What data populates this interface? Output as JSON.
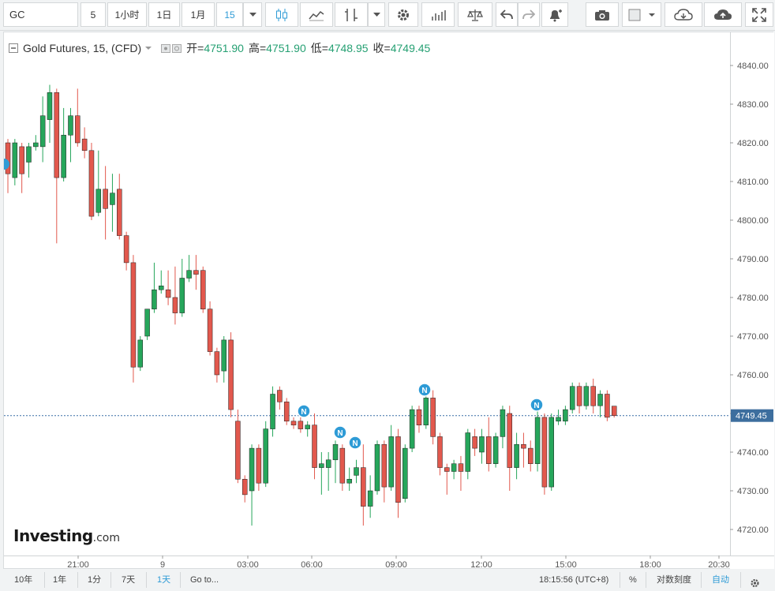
{
  "toolbar": {
    "symbol": "GC",
    "intervals": [
      "5",
      "1小时",
      "1日",
      "1月",
      "15"
    ],
    "active_interval": "15"
  },
  "legend": {
    "title": "Gold Futures, 15, (CFD)",
    "open_label": "开=",
    "open": "4751.90",
    "high_label": "高=",
    "high": "4751.90",
    "low_label": "低=",
    "low": "4748.95",
    "close_label": "收=",
    "close": "4749.45"
  },
  "logo": {
    "main": "Investing",
    "suffix": ".com"
  },
  "bottom": {
    "ranges": [
      "10年",
      "1年",
      "1分",
      "7天",
      "1天"
    ],
    "active_range": "1天",
    "goto": "Go to...",
    "clock": "18:15:56 (UTC+8)",
    "percent": "%",
    "log": "对数刻度",
    "auto": "自动"
  },
  "colors": {
    "up": "#26a65b",
    "down": "#e2584d",
    "accent": "#2e9bd6",
    "price_line": "#3a6ea5",
    "price_tag": "#3d6e9e"
  },
  "chart_data": {
    "type": "candlestick",
    "yticks": [
      4720,
      4730,
      4740,
      4750,
      4760,
      4770,
      4780,
      4790,
      4800,
      4810,
      4820,
      4830,
      4840
    ],
    "ylim": [
      4718,
      4843
    ],
    "xticks": [
      "21:00",
      "9",
      "03:00",
      "06:00",
      "09:00",
      "12:00",
      "15:00",
      "18:00",
      "20:30"
    ],
    "current_price": "4749.45",
    "news_markers": [
      "N",
      "N",
      "N",
      "N",
      "N"
    ],
    "candles": [
      [
        4820,
        4812,
        4821,
        4807
      ],
      [
        4811,
        4820,
        4821,
        4809
      ],
      [
        4819,
        4812,
        4820,
        4807
      ],
      [
        4815,
        4819,
        4820,
        4811
      ],
      [
        4819,
        4820,
        4822,
        4818
      ],
      [
        4819,
        4827,
        4832,
        4815
      ],
      [
        4826,
        4833,
        4835,
        4820
      ],
      [
        4833,
        4811,
        4834,
        4794
      ],
      [
        4811,
        4822,
        4829,
        4810
      ],
      [
        4822,
        4827,
        4829,
        4815
      ],
      [
        4827,
        4820,
        4834,
        4819
      ],
      [
        4821,
        4818,
        4824,
        4816
      ],
      [
        4818,
        4801,
        4820,
        4800
      ],
      [
        4802,
        4808,
        4818,
        4801
      ],
      [
        4808,
        4803,
        4814,
        4795
      ],
      [
        4804,
        4807,
        4812,
        4797
      ],
      [
        4808,
        4796,
        4812,
        4795
      ],
      [
        4796,
        4789,
        4797,
        4787
      ],
      [
        4789,
        4762,
        4791,
        4758
      ],
      [
        4762,
        4769,
        4770,
        4761
      ],
      [
        4770,
        4777,
        4777,
        4769
      ],
      [
        4777,
        4782,
        4789,
        4776
      ],
      [
        4782,
        4783,
        4787,
        4781
      ],
      [
        4782,
        4780,
        4787,
        4778
      ],
      [
        4780,
        4776,
        4788,
        4773
      ],
      [
        4776,
        4785,
        4790,
        4775
      ],
      [
        4785,
        4787,
        4791,
        4784
      ],
      [
        4787,
        4786,
        4791,
        4782
      ],
      [
        4787,
        4777,
        4788,
        4776
      ],
      [
        4777,
        4766,
        4779,
        4765
      ],
      [
        4766,
        4760,
        4767,
        4758
      ],
      [
        4761,
        4769,
        4770,
        4758
      ],
      [
        4769,
        4751,
        4771,
        4749
      ],
      [
        4748,
        4733,
        4751,
        4732
      ],
      [
        4733,
        4729,
        4734,
        4727
      ],
      [
        4730,
        4741,
        4742,
        4721
      ],
      [
        4741,
        4732,
        4742,
        4730
      ],
      [
        4732,
        4746,
        4748,
        4731
      ],
      [
        4746,
        4755,
        4757,
        4744
      ],
      [
        4756,
        4753,
        4757,
        4751
      ],
      [
        4753,
        4748,
        4754,
        4747
      ],
      [
        4748,
        4747,
        4749,
        4746
      ],
      [
        4748,
        4746,
        4749,
        4745
      ],
      [
        4746,
        4747,
        4748,
        4744
      ],
      [
        4747,
        4736,
        4750,
        4733
      ],
      [
        4736,
        4737,
        4740,
        4729
      ],
      [
        4736,
        4738,
        4740,
        4730
      ],
      [
        4738,
        4742,
        4743,
        4732
      ],
      [
        4741,
        4732,
        4742,
        4730
      ],
      [
        4732,
        4733,
        4736,
        4730
      ],
      [
        4734,
        4736,
        4738,
        4732
      ],
      [
        4736,
        4726,
        4742,
        4721
      ],
      [
        4726,
        4730,
        4734,
        4723
      ],
      [
        4730,
        4742,
        4743,
        4729
      ],
      [
        4742,
        4731,
        4743,
        4727
      ],
      [
        4731,
        4744,
        4747,
        4730
      ],
      [
        4744,
        4727,
        4746,
        4723
      ],
      [
        4728,
        4741,
        4742,
        4727
      ],
      [
        4741,
        4751,
        4752,
        4740
      ],
      [
        4751,
        4747,
        4752,
        4745
      ],
      [
        4747,
        4754,
        4756,
        4746
      ],
      [
        4754,
        4744,
        4756,
        4742
      ],
      [
        4744,
        4736,
        4745,
        4734
      ],
      [
        4736,
        4735,
        4737,
        4729
      ],
      [
        4735,
        4737,
        4738,
        4733
      ],
      [
        4737,
        4735,
        4739,
        4730
      ],
      [
        4735,
        4745,
        4746,
        4733
      ],
      [
        4744,
        4741,
        4746,
        4739
      ],
      [
        4740,
        4744,
        4746,
        4737
      ],
      [
        4744,
        4737,
        4749,
        4735
      ],
      [
        4737,
        4744,
        4745,
        4736
      ],
      [
        4744,
        4751,
        4752,
        4741
      ],
      [
        4750,
        4736,
        4752,
        4730
      ],
      [
        4736,
        4742,
        4745,
        4733
      ],
      [
        4742,
        4741,
        4745,
        4736
      ],
      [
        4741,
        4737,
        4743,
        4735
      ],
      [
        4737,
        4749,
        4752,
        4735
      ],
      [
        4749,
        4731,
        4750,
        4729
      ],
      [
        4731,
        4749,
        4750,
        4730
      ],
      [
        4748,
        4749,
        4751,
        4747
      ],
      [
        4748,
        4751,
        4752,
        4747
      ],
      [
        4751,
        4757,
        4758,
        4750
      ],
      [
        4757,
        4752,
        4758,
        4750
      ],
      [
        4752,
        4757,
        4758,
        4751
      ],
      [
        4757,
        4752,
        4759,
        4750
      ],
      [
        4752,
        4755,
        4756,
        4749
      ],
      [
        4755,
        4749,
        4756,
        4748
      ],
      [
        4751.9,
        4749.45,
        4751.9,
        4748.95
      ]
    ]
  }
}
